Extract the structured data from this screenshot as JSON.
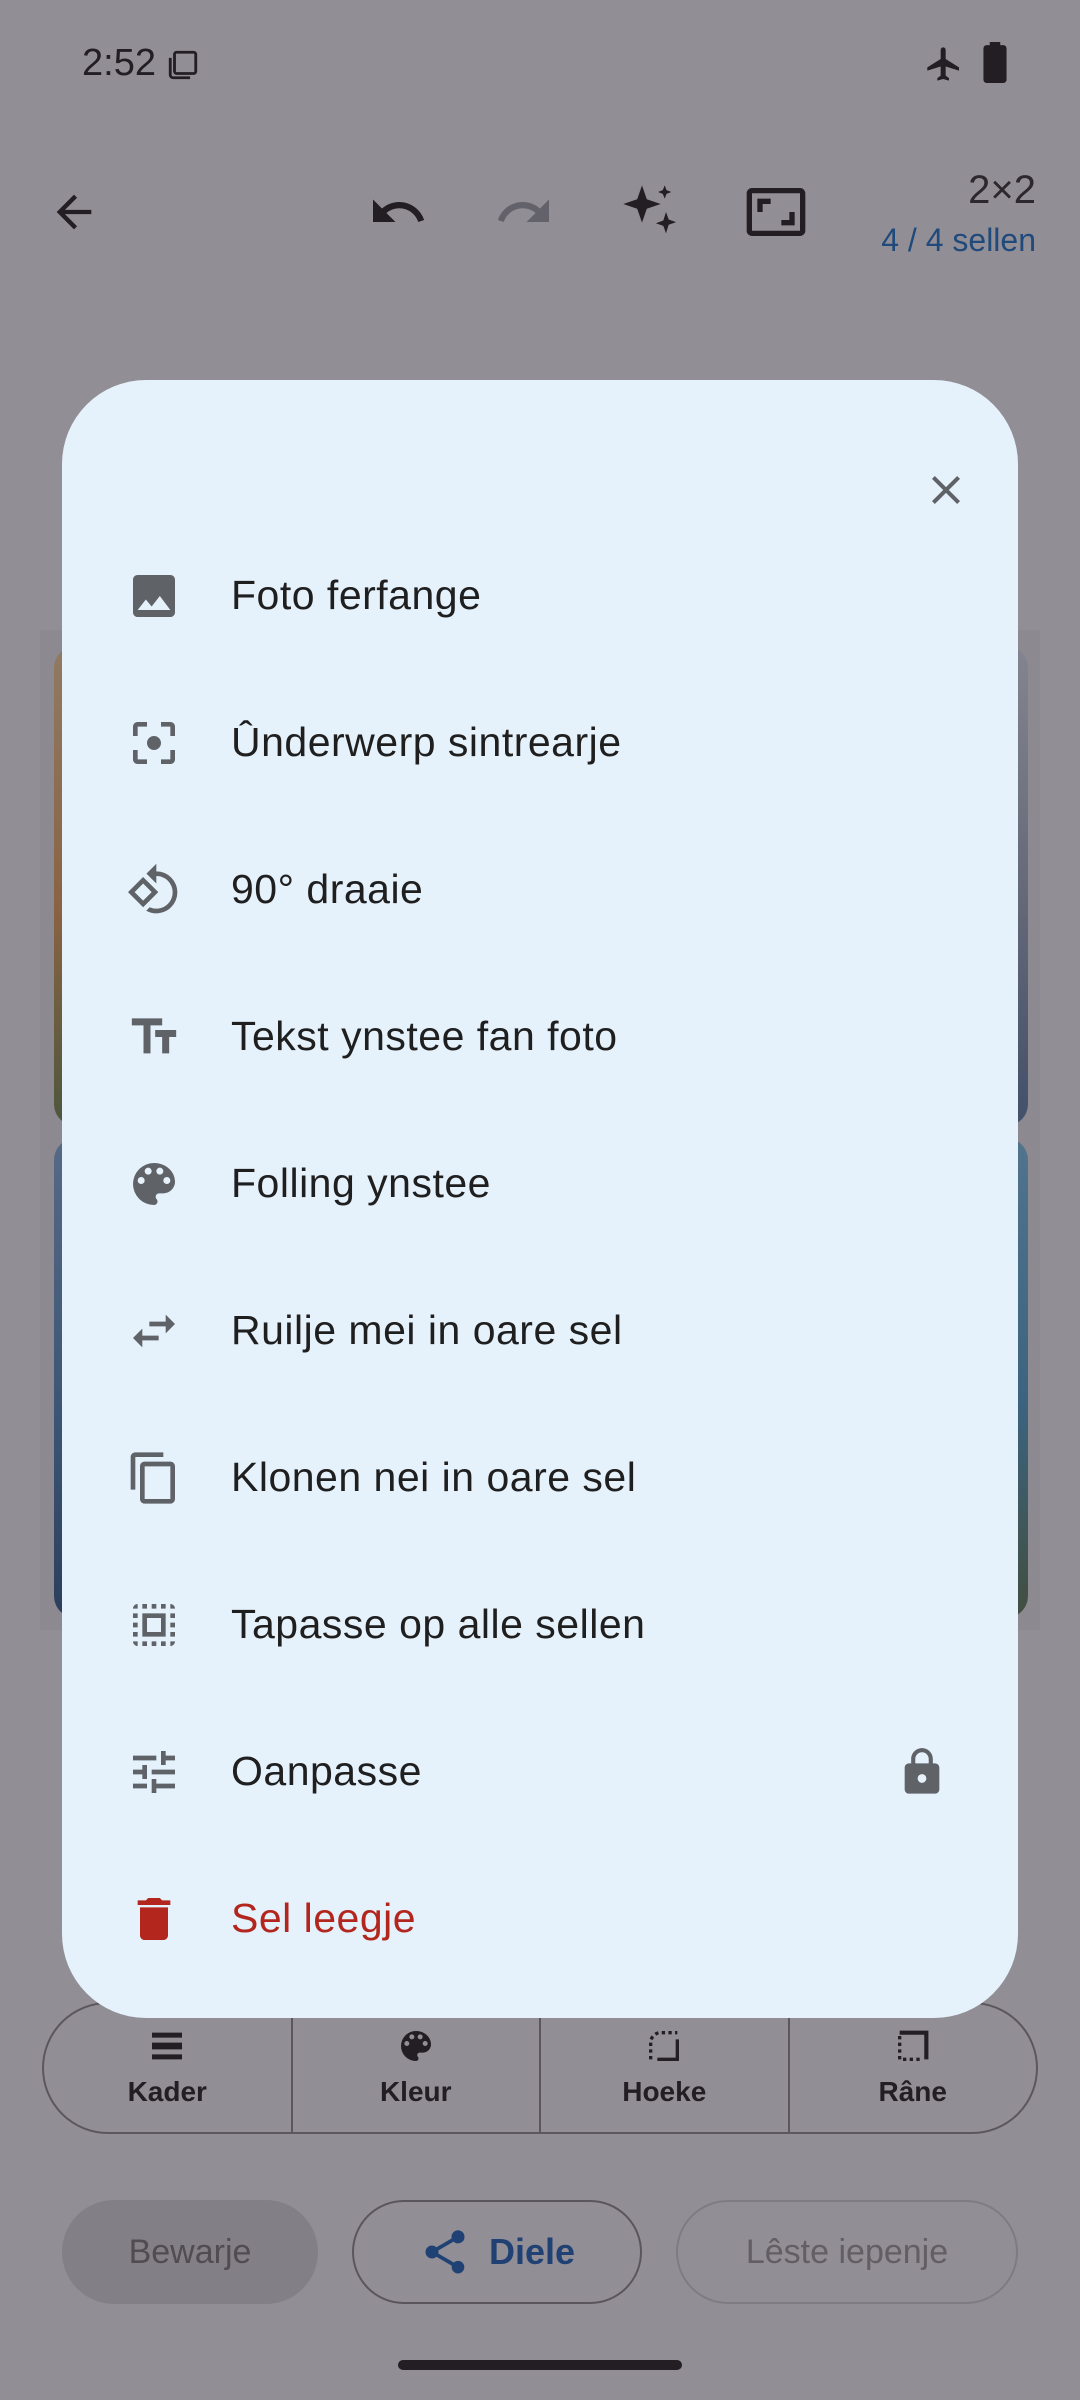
{
  "status_bar": {
    "time": "2:52"
  },
  "app_bar": {
    "grid_size": "2×2",
    "cell_count": "4 / 4 sellen"
  },
  "toolbar": {
    "items": [
      {
        "label": "Kader",
        "icon": "frame-icon"
      },
      {
        "label": "Kleur",
        "icon": "palette-icon"
      },
      {
        "label": "Hoeke",
        "icon": "rounded-corner-icon"
      },
      {
        "label": "Râne",
        "icon": "border-icon"
      }
    ]
  },
  "actions": {
    "save_label": "Bewarje",
    "share_label": "Diele",
    "last_open_label": "Lêste iepenje"
  },
  "menu": {
    "items": [
      {
        "label": "Foto ferfange",
        "icon": "image-icon"
      },
      {
        "label": "Ûnderwerp sintrearje",
        "icon": "center-focus-icon"
      },
      {
        "label": "90° draaie",
        "icon": "rotate-icon"
      },
      {
        "label": "Tekst ynstee fan foto",
        "icon": "text-fields-icon"
      },
      {
        "label": "Folling ynstee",
        "icon": "palette-icon"
      },
      {
        "label": "Ruilje mei in oare sel",
        "icon": "swap-icon"
      },
      {
        "label": "Klonen nei in oare sel",
        "icon": "copy-icon"
      },
      {
        "label": "Tapasse op alle sellen",
        "icon": "select-all-icon"
      },
      {
        "label": "Oanpasse",
        "icon": "tune-icon",
        "locked": true
      },
      {
        "label": "Sel leegje",
        "icon": "trash-icon",
        "danger": true
      }
    ]
  },
  "colors": {
    "accent": "#1a73c8",
    "danger": "#b3261e",
    "sheet_bg": "#e5f1fb",
    "icon": "#5f6368"
  }
}
